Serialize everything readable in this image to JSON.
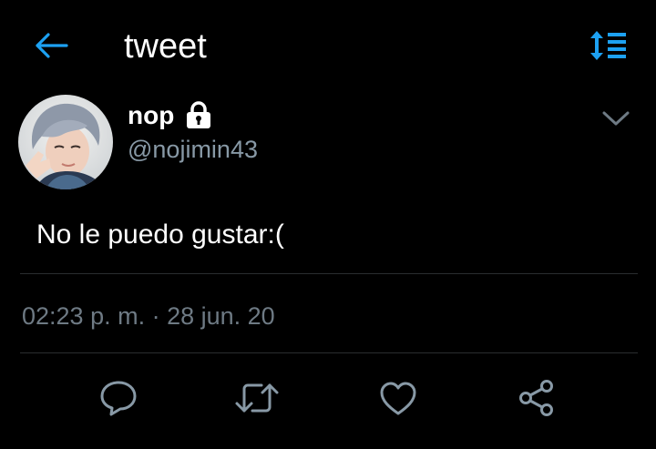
{
  "header": {
    "title": "tweet",
    "back_icon": "arrow-left-icon",
    "sort_icon": "sort-list-icon",
    "accent": "#1da1f2"
  },
  "tweet": {
    "display_name": "nop",
    "handle": "@nojimin43",
    "protected_icon": "lock-icon",
    "text": "No le puedo gustar:(",
    "timestamp": "02:23 p. m. · 28 jun. 20"
  },
  "actions": [
    {
      "name": "reply",
      "icon": "reply-icon"
    },
    {
      "name": "retweet",
      "icon": "retweet-icon"
    },
    {
      "name": "like",
      "icon": "heart-icon"
    },
    {
      "name": "share",
      "icon": "share-icon"
    }
  ],
  "colors": {
    "background": "#000000",
    "primary_text": "#ffffff",
    "secondary_text": "#8899a6",
    "divider": "#2a2d30"
  }
}
